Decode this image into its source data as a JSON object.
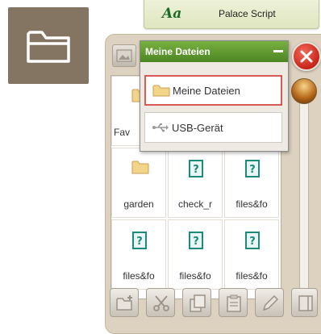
{
  "font_row": {
    "sample": "Aa",
    "name": "Palace Script"
  },
  "dropdown": {
    "title": "Meine Dateien",
    "options": [
      {
        "label": "Meine Dateien",
        "icon": "folder-icon",
        "selected": true
      },
      {
        "label": "USB-Gerät",
        "icon": "usb-icon",
        "selected": false
      }
    ]
  },
  "grid": {
    "cells": [
      {
        "label": "Fav",
        "icon": "folder-icon"
      },
      {
        "label": "",
        "icon": ""
      },
      {
        "label": "",
        "icon": ""
      },
      {
        "label": "garden",
        "icon": "folder-icon"
      },
      {
        "label": "check_r",
        "icon": "unknown-file-icon"
      },
      {
        "label": "files&fo",
        "icon": "unknown-file-icon"
      },
      {
        "label": "files&fo",
        "icon": "unknown-file-icon"
      },
      {
        "label": "files&fo",
        "icon": "unknown-file-icon"
      },
      {
        "label": "files&fo",
        "icon": "unknown-file-icon"
      }
    ]
  },
  "toolbar": [
    "new-folder-icon",
    "cut-icon",
    "copy-icon",
    "paste-icon",
    "rename-pencil-icon",
    "more-icon"
  ],
  "colors": {
    "accent_green": "#5a9a2e",
    "close_red": "#d2291b",
    "panel_bg": "#ddd2c0"
  }
}
